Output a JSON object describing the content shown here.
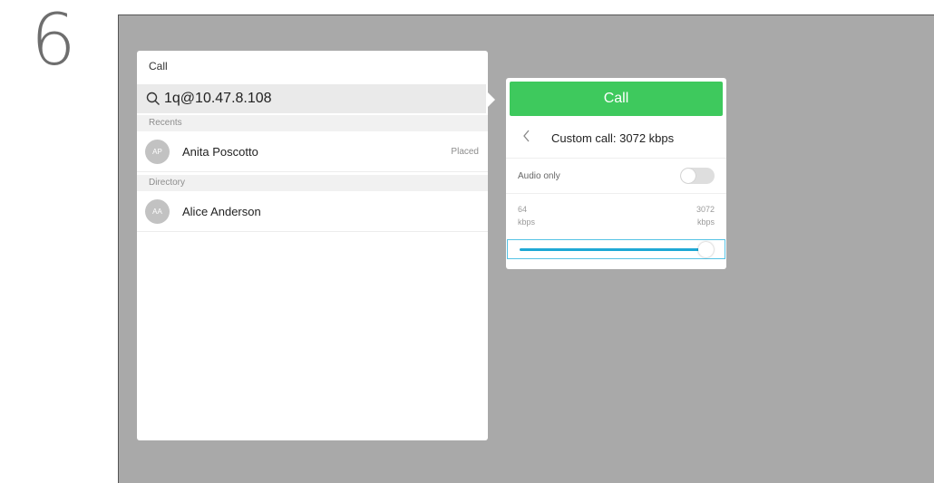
{
  "step": {
    "number": "6"
  },
  "call_panel": {
    "title": "Call",
    "search": {
      "value": "1q@10.47.8.108",
      "icon": "search-icon"
    },
    "recents": {
      "header": "Recents",
      "items": [
        {
          "initials": "AP",
          "name": "Anita Poscotto",
          "status": "Placed"
        }
      ]
    },
    "directory": {
      "header": "Directory",
      "items": [
        {
          "initials": "AA",
          "name": "Alice Anderson"
        }
      ]
    }
  },
  "popup": {
    "call_label": "Call",
    "back_icon": "chevron-left-icon",
    "custom_call_label": "Custom call: 3072 kbps",
    "audio_only_label": "Audio only",
    "audio_only_enabled": false,
    "range": {
      "min_value": "64",
      "min_unit": "kbps",
      "max_value": "3072",
      "max_unit": "kbps"
    },
    "slider_value_fraction": 1.0
  },
  "colors": {
    "call_button": "#3ec95d",
    "slider_fill": "#1ea8d5",
    "focus_border": "#55c3e5",
    "background": "#a9a9a9"
  }
}
